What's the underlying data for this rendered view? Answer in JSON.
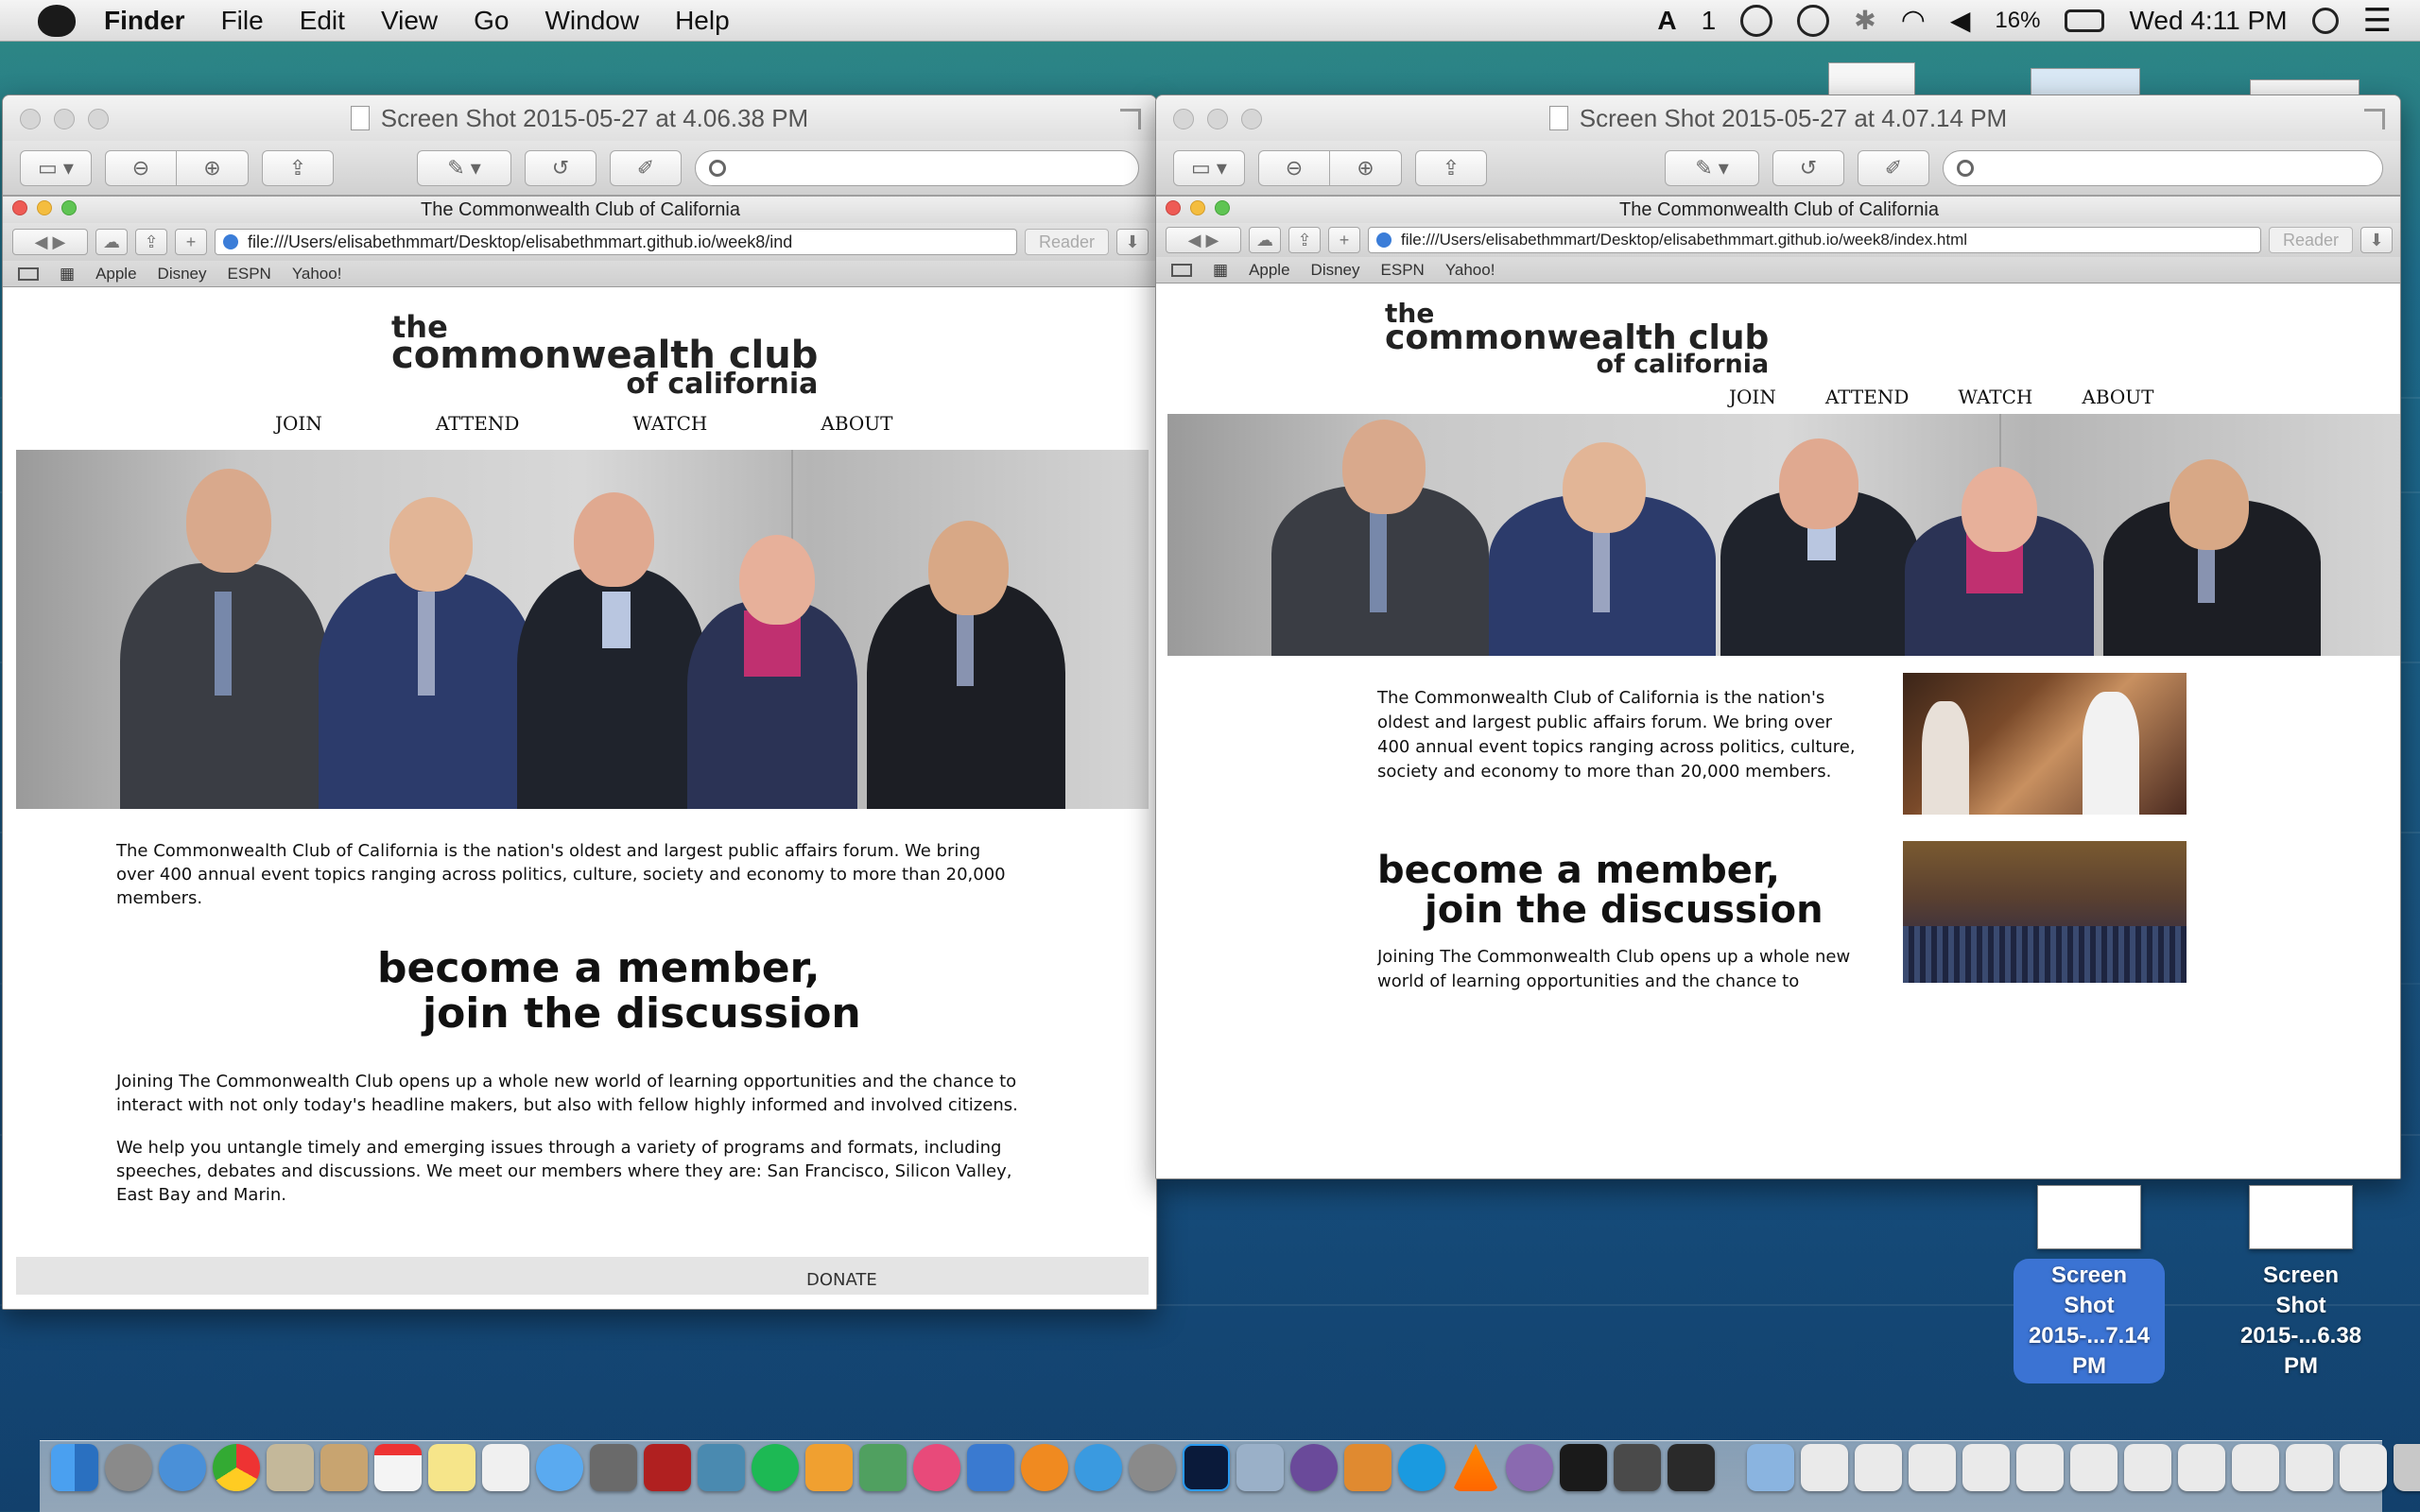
{
  "menubar": {
    "app_name": "Finder",
    "menus": [
      "File",
      "Edit",
      "View",
      "Go",
      "Window",
      "Help"
    ],
    "adobe_count": "1",
    "battery": "16%",
    "clock": "Wed 4:11 PM"
  },
  "preview_left": {
    "title": "Screen Shot 2015-05-27 at 4.06.38 PM"
  },
  "preview_right": {
    "title": "Screen Shot 2015-05-27 at 4.07.14 PM"
  },
  "safari_left": {
    "title": "The Commonwealth Club of California",
    "url": "file:///Users/elisabethmmart/Desktop/elisabethmmart.github.io/week8/ind",
    "reader": "Reader",
    "bookmarks": [
      "Apple",
      "Disney",
      "ESPN",
      "Yahoo!"
    ]
  },
  "safari_right": {
    "title": "The Commonwealth Club of California",
    "url": "file:///Users/elisabethmmart/Desktop/elisabethmmart.github.io/week8/index.html",
    "reader": "Reader",
    "bookmarks": [
      "Apple",
      "Disney",
      "ESPN",
      "Yahoo!"
    ]
  },
  "site": {
    "logo_line1": "the",
    "logo_line2": "commonwealth club",
    "logo_line3": "of california",
    "nav": [
      "JOIN",
      "ATTEND",
      "WATCH",
      "ABOUT"
    ],
    "intro": "The Commonwealth Club of California is the nation's oldest and largest public affairs forum. We bring over 400 annual event topics ranging across politics, culture, society and economy to more than 20,000 members.",
    "headline1": "become a member,",
    "headline2": "join the discussion",
    "para1": "Joining The Commonwealth Club opens up a whole new world of learning opportunities and the chance to interact with not only today's headline makers, but also with fellow highly informed and involved citizens.",
    "para1_partial": "Joining The Commonwealth Club opens up a whole new world of learning opportunities and the chance to interact",
    "para2": "We help you untangle timely and emerging issues through a variety of programs and formats, including speeches, debates and discussions. We meet our members where they are: San Francisco, Silicon Valley, East Bay and Marin.",
    "donate": "DONATE"
  },
  "desktop_files": [
    {
      "line1": "Screen Shot",
      "line2": "2015-...7.14 PM"
    },
    {
      "line1": "Screen Shot",
      "line2": "2015-...6.38 PM"
    }
  ],
  "colors": {
    "selection_blue": "#3b73d3",
    "logo_text": "#222222"
  },
  "icons": {
    "menubar": [
      "apple-icon",
      "adobe-icon",
      "creative-cloud-icon",
      "time-machine-icon",
      "bluetooth-icon",
      "wifi-icon",
      "volume-icon",
      "battery-icon",
      "spotlight-icon",
      "notification-center-icon"
    ],
    "dock": [
      "finder-icon",
      "launchpad-icon",
      "safari-icon",
      "chrome-icon",
      "mail-icon",
      "contacts-icon",
      "calendar-icon",
      "notes-icon",
      "reminders-icon",
      "messages-icon",
      "facetime-icon",
      "photo-booth-icon",
      "iphoto-icon",
      "spotify-icon",
      "pages-icon",
      "numbers-icon",
      "itunes-icon",
      "keynote-icon",
      "ibooks-icon",
      "app-store-icon",
      "system-preferences-icon",
      "photoshop-icon",
      "preview-icon",
      "github-icon",
      "sublime-icon",
      "skype-icon",
      "vlc-icon",
      "bittorrent-icon",
      "terminal-icon",
      "x11-icon",
      "unknown-app-icon",
      "folder-icon",
      "trash-icon"
    ]
  }
}
